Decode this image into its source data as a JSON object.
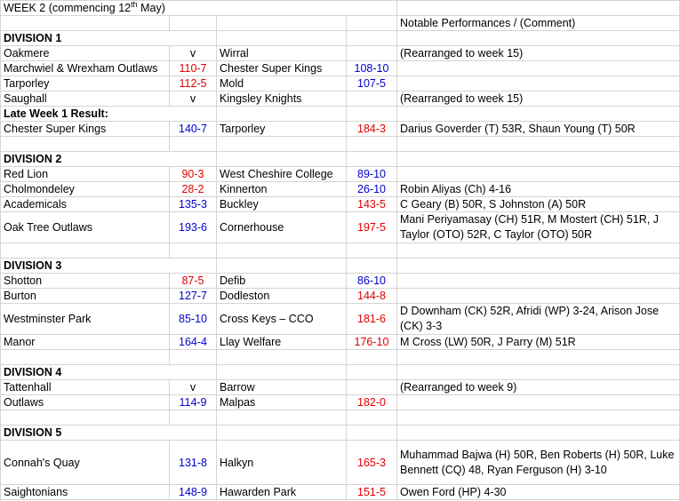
{
  "colors": {
    "home_win": "#e00000",
    "away_win": "#0000cc",
    "grid": "#d4d4d4"
  },
  "title": {
    "text": "WEEK 2 (commencing 12",
    "sup": "th",
    "after": " May)"
  },
  "comment_header": "Notable Performances / (Comment)",
  "rows": [
    {
      "type": "empty",
      "h": 16
    },
    {
      "type": "header",
      "label": "DIVISION 1",
      "h": 17
    },
    {
      "type": "match",
      "home": "Oakmere",
      "hs": "v",
      "away": "Wirral",
      "as": "",
      "note": "(Rearranged to week 15)",
      "hc": "",
      "ac": "",
      "h": 17
    },
    {
      "type": "match",
      "home": "Marchwiel & Wrexham Outlaws",
      "hs": "110-7",
      "away": "Chester Super Kings",
      "as": "108-10",
      "note": "",
      "hc": "red",
      "ac": "blue",
      "h": 17
    },
    {
      "type": "match",
      "home": "Tarporley",
      "hs": "112-5",
      "away": "Mold",
      "as": "107-5",
      "note": "",
      "hc": "red",
      "ac": "blue",
      "h": 17
    },
    {
      "type": "match",
      "home": "Saughall",
      "hs": "v",
      "away": "Kingsley Knights",
      "as": "",
      "note": "(Rearranged to week 15)",
      "hc": "",
      "ac": "",
      "h": 17
    },
    {
      "type": "header",
      "label": "Late Week 1 Result:",
      "h": 17
    },
    {
      "type": "match",
      "home": "Chester Super Kings",
      "hs": "140-7",
      "away": "Tarporley",
      "as": "184-3",
      "note": "Darius Goverder (T) 53R, Shaun Young (T) 50R",
      "hc": "blue",
      "ac": "red",
      "h": 17
    },
    {
      "type": "empty",
      "h": 17
    },
    {
      "type": "header",
      "label": "DIVISION 2",
      "h": 17
    },
    {
      "type": "match",
      "home": "Red Lion",
      "hs": "90-3",
      "away": "West Cheshire College",
      "as": "89-10",
      "note": "",
      "hc": "red",
      "ac": "blue",
      "h": 17
    },
    {
      "type": "match",
      "home": "Cholmondeley",
      "hs": "28-2",
      "away": "Kinnerton",
      "as": "26-10",
      "note": "Robin Aliyas (Ch) 4-16",
      "hc": "red",
      "ac": "blue",
      "h": 17
    },
    {
      "type": "match",
      "home": "Academicals",
      "hs": "135-3",
      "away": "Buckley",
      "as": "143-5",
      "note": "C Geary (B) 50R, S Johnston (A) 50R",
      "hc": "blue",
      "ac": "red",
      "h": 17
    },
    {
      "type": "match",
      "home": "Oak Tree Outlaws",
      "hs": "193-6",
      "away": "Cornerhouse",
      "as": "197-5",
      "note": "Mani Periyamasay (CH) 51R, M Mostert (CH) 51R, J Taylor (OTO) 52R, C Taylor (OTO) 50R",
      "hc": "blue",
      "ac": "red",
      "h": 34,
      "wrap": true
    },
    {
      "type": "empty",
      "h": 17
    },
    {
      "type": "header",
      "label": "DIVISION 3",
      "h": 17
    },
    {
      "type": "match",
      "home": "Shotton",
      "hs": "87-5",
      "away": "Defib",
      "as": "86-10",
      "note": "",
      "hc": "red",
      "ac": "blue",
      "h": 17
    },
    {
      "type": "match",
      "home": "Burton",
      "hs": "127-7",
      "away": "Dodleston",
      "as": "144-8",
      "note": "",
      "hc": "blue",
      "ac": "red",
      "h": 17
    },
    {
      "type": "match",
      "home": "Westminster Park",
      "hs": "85-10",
      "away": "Cross Keys – CCO",
      "as": "181-6",
      "note": "D Downham (CK) 52R, Afridi (WP) 3-24, Arison Jose (CK) 3-3",
      "hc": "blue",
      "ac": "red",
      "h": 34,
      "wrap": true
    },
    {
      "type": "match",
      "home": "Manor",
      "hs": "164-4",
      "away": "Llay Welfare",
      "as": "176-10",
      "note": "M Cross (LW) 50R, J Parry (M) 51R",
      "hc": "blue",
      "ac": "red",
      "h": 17
    },
    {
      "type": "empty",
      "h": 17
    },
    {
      "type": "header",
      "label": "DIVISION 4",
      "h": 17
    },
    {
      "type": "match",
      "home": "Tattenhall",
      "hs": "v",
      "away": "Barrow",
      "as": "",
      "note": "(Rearranged to week 9)",
      "hc": "",
      "ac": "",
      "h": 17
    },
    {
      "type": "match",
      "home": "Outlaws",
      "hs": "114-9",
      "away": "Malpas",
      "as": "182-0",
      "note": "",
      "hc": "blue",
      "ac": "red",
      "h": 17
    },
    {
      "type": "empty",
      "h": 17
    },
    {
      "type": "header",
      "label": "DIVISION 5",
      "h": 17
    },
    {
      "type": "match",
      "home": "Connah's Quay",
      "hs": "131-8",
      "away": "Halkyn",
      "as": "165-3",
      "note": "Muhammad Bajwa (H) 50R, Ben Roberts (H) 50R, Luke Bennett (CQ) 48, Ryan Ferguson (H) 3-10",
      "hc": "blue",
      "ac": "red",
      "h": 50,
      "wrap": true
    },
    {
      "type": "match",
      "home": "Saightonians",
      "hs": "148-9",
      "away": "Hawarden Park",
      "as": "151-5",
      "note": "Owen Ford (HP) 4-30",
      "hc": "blue",
      "ac": "red",
      "h": 17
    }
  ]
}
